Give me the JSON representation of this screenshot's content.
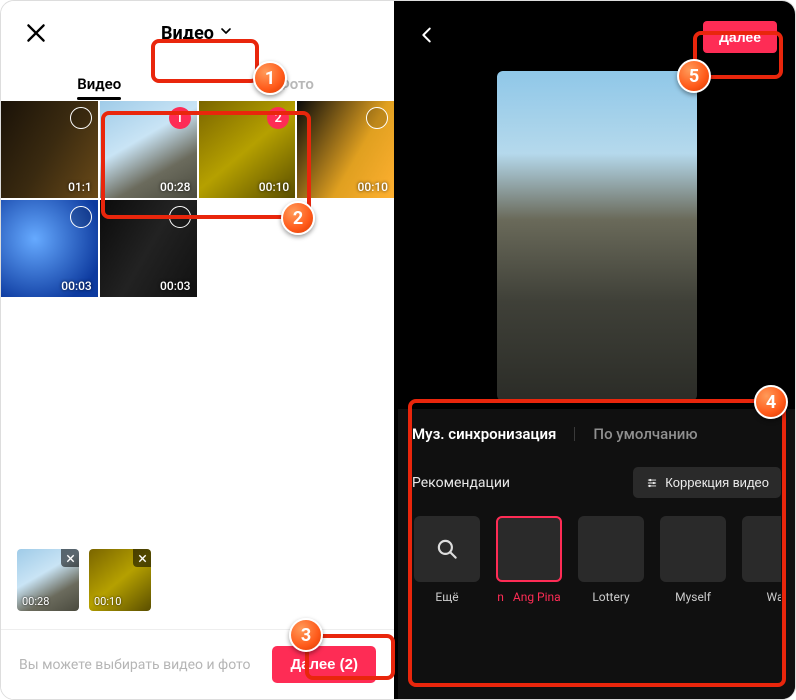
{
  "left": {
    "dropdown_label": "Видео",
    "tabs": {
      "videos": "Видео",
      "photos": "Фото"
    },
    "grid": [
      {
        "id": "city",
        "img": "img-city",
        "duration": "01:1",
        "selected": null
      },
      {
        "id": "blossom",
        "img": "img-blossom",
        "duration": "00:28",
        "selected": 1
      },
      {
        "id": "yellow",
        "img": "img-yellow",
        "duration": "00:10",
        "selected": 2
      },
      {
        "id": "lights",
        "img": "img-lights",
        "duration": "00:10",
        "selected": null
      },
      {
        "id": "blue",
        "img": "img-blue",
        "duration": "00:03",
        "selected": null
      },
      {
        "id": "dark",
        "img": "img-dark",
        "duration": "00:03",
        "selected": null
      }
    ],
    "selected_thumbs": [
      {
        "img": "img-blossom",
        "duration": "00:28"
      },
      {
        "img": "img-yellow",
        "duration": "00:10"
      }
    ],
    "hint": "Вы можете выбирать видео и фото",
    "next_label": "Далее (2)"
  },
  "right": {
    "next_label": "Далее",
    "panel_tabs": {
      "sync": "Муз. синхронизация",
      "default": "По умолчанию"
    },
    "reco_label": "Рекомендации",
    "correct_label": "Коррекция видео",
    "tracks": [
      {
        "id": "more",
        "name": "Ещё",
        "img": "search"
      },
      {
        "id": "t1",
        "name": "Ang Pina",
        "img": "img-album1",
        "active": true,
        "truncated_prefix": "n"
      },
      {
        "id": "t2",
        "name": "Lottery",
        "img": "img-album2"
      },
      {
        "id": "t3",
        "name": "Myself",
        "img": "img-album3"
      },
      {
        "id": "t4",
        "name": "Wa",
        "img": "img-dark"
      }
    ]
  },
  "steps": {
    "s1": "1",
    "s2": "2",
    "s3": "3",
    "s4": "4",
    "s5": "5"
  },
  "colors": {
    "accent": "#fe2c55",
    "callout": "#e9260c"
  }
}
